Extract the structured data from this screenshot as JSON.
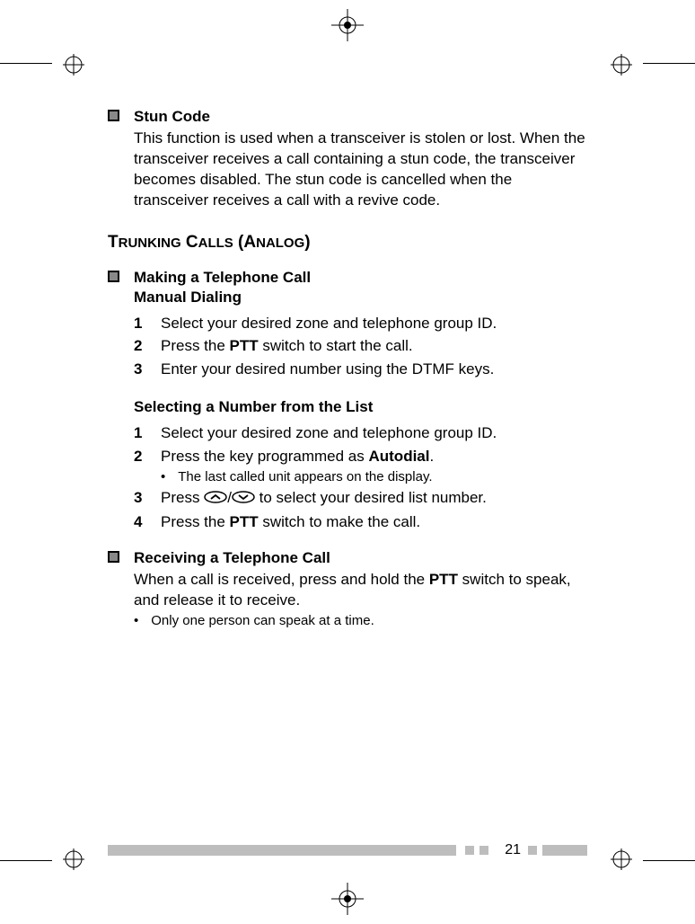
{
  "sections": {
    "stun_code": {
      "heading": "Stun Code",
      "body": "This function is used when a transceiver is stolen or lost. When the transceiver receives a call containing a stun code, the transceiver becomes disabled.  The stun code is cancelled when the transceiver receives a call with a revive code."
    },
    "trunking_heading_prefix": "T",
    "trunking_heading_word1": "RUNKING",
    "trunking_heading_c": " C",
    "trunking_heading_word2": "ALLS",
    "trunking_heading_paren1": " (A",
    "trunking_heading_word3": "NALOG",
    "trunking_heading_paren2": ")",
    "making_call": {
      "heading": "Making a Telephone Call",
      "manual": {
        "heading": "Manual Dialing",
        "steps": [
          "Select your desired zone and telephone group ID.",
          [
            "Press the ",
            "PTT",
            " switch to start the call."
          ],
          "Enter your desired number using the DTMF keys."
        ]
      },
      "selecting": {
        "heading": "Selecting a Number from the List",
        "steps": {
          "s1": "Select your desired zone and telephone group ID.",
          "s2_pre": "Press the key programmed as ",
          "s2_bold": "Autodial",
          "s2_post": ".",
          "s2_sub": "The last called unit appears on the display.",
          "s3_pre": "Press ",
          "s3_post": " to select your desired list number.",
          "s4_pre": "Press the ",
          "s4_bold": "PTT",
          "s4_post": " switch to make the call."
        }
      }
    },
    "receiving_call": {
      "heading": "Receiving a Telephone Call",
      "body_pre": "When a call is received, press and hold the ",
      "body_bold": "PTT",
      "body_post": " switch to speak, and release it to receive.",
      "sub": "Only one person can speak at a time."
    }
  },
  "nums": {
    "n1": "1",
    "n2": "2",
    "n3": "3",
    "n4": "4"
  },
  "page_number": "21",
  "bullet_char": "•",
  "slash": "/"
}
